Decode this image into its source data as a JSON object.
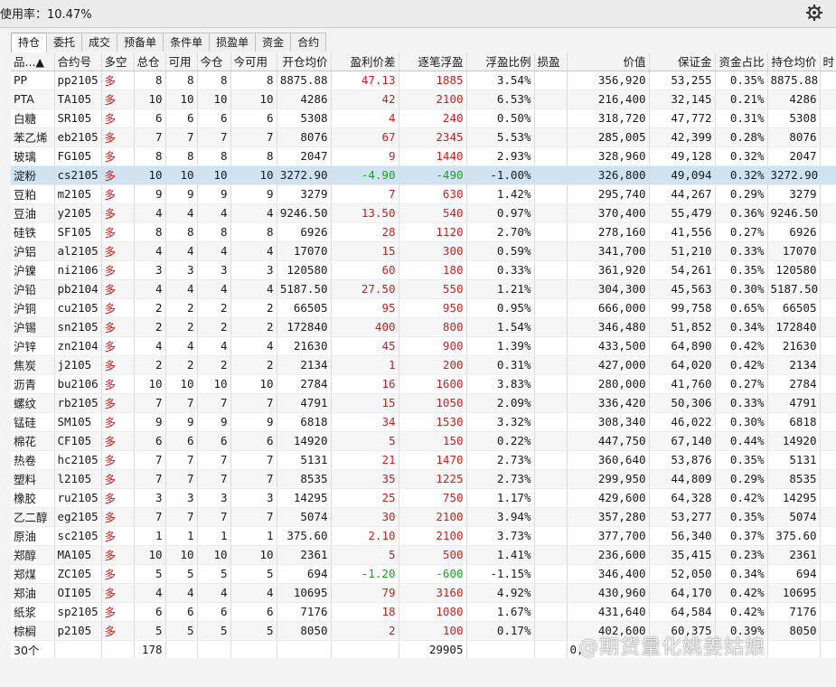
{
  "topbar": {
    "usage_text": "使用率：10.47%"
  },
  "tabs": [
    "持仓",
    "委托",
    "成交",
    "预备单",
    "条件单",
    "损盈单",
    "资金",
    "合约"
  ],
  "columns": [
    "品...▲",
    "合约号",
    "多空",
    "总仓",
    "可用",
    "今仓",
    "今可用",
    "开仓均价",
    "盈利价差",
    "逐笔浮盈",
    "浮盈比例",
    "损盈",
    "价值",
    "保证金",
    "资金占比",
    "持仓均价",
    "时"
  ],
  "rows": [
    [
      "PP",
      "pp2105",
      "多",
      "8",
      "8",
      "8",
      "8",
      "8875.88",
      "47.13",
      "1885",
      "3.54%",
      "",
      "356,920",
      "53,255",
      "0.35%",
      "8875.88"
    ],
    [
      "PTA",
      "TA105",
      "多",
      "10",
      "10",
      "10",
      "10",
      "4286",
      "42",
      "2100",
      "6.53%",
      "",
      "216,400",
      "32,145",
      "0.21%",
      "4286"
    ],
    [
      "白糖",
      "SR105",
      "多",
      "6",
      "6",
      "6",
      "6",
      "5308",
      "4",
      "240",
      "0.50%",
      "",
      "318,720",
      "47,772",
      "0.31%",
      "5308"
    ],
    [
      "苯乙烯",
      "eb2105",
      "多",
      "7",
      "7",
      "7",
      "7",
      "8076",
      "67",
      "2345",
      "5.53%",
      "",
      "285,005",
      "42,399",
      "0.28%",
      "8076"
    ],
    [
      "玻璃",
      "FG105",
      "多",
      "8",
      "8",
      "8",
      "8",
      "2047",
      "9",
      "1440",
      "2.93%",
      "",
      "328,960",
      "49,128",
      "0.32%",
      "2047"
    ],
    [
      "淀粉",
      "cs2105",
      "多",
      "10",
      "10",
      "10",
      "10",
      "3272.90",
      "-4.90",
      "-490",
      "-1.00%",
      "",
      "326,800",
      "49,094",
      "0.32%",
      "3272.90"
    ],
    [
      "豆粕",
      "m2105",
      "多",
      "9",
      "9",
      "9",
      "9",
      "3279",
      "7",
      "630",
      "1.42%",
      "",
      "295,740",
      "44,267",
      "0.29%",
      "3279"
    ],
    [
      "豆油",
      "y2105",
      "多",
      "4",
      "4",
      "4",
      "4",
      "9246.50",
      "13.50",
      "540",
      "0.97%",
      "",
      "370,400",
      "55,479",
      "0.36%",
      "9246.50"
    ],
    [
      "硅铁",
      "SF105",
      "多",
      "8",
      "8",
      "8",
      "8",
      "6926",
      "28",
      "1120",
      "2.70%",
      "",
      "278,160",
      "41,556",
      "0.27%",
      "6926"
    ],
    [
      "沪铝",
      "al2105",
      "多",
      "4",
      "4",
      "4",
      "4",
      "17070",
      "15",
      "300",
      "0.59%",
      "",
      "341,700",
      "51,210",
      "0.33%",
      "17070"
    ],
    [
      "沪镍",
      "ni2106",
      "多",
      "3",
      "3",
      "3",
      "3",
      "120580",
      "60",
      "180",
      "0.33%",
      "",
      "361,920",
      "54,261",
      "0.35%",
      "120580"
    ],
    [
      "沪铅",
      "pb2104",
      "多",
      "4",
      "4",
      "4",
      "4",
      "5187.50",
      "27.50",
      "550",
      "1.21%",
      "",
      "304,300",
      "45,563",
      "0.30%",
      "5187.50"
    ],
    [
      "沪铜",
      "cu2105",
      "多",
      "2",
      "2",
      "2",
      "2",
      "66505",
      "95",
      "950",
      "0.95%",
      "",
      "666,000",
      "99,758",
      "0.65%",
      "66505"
    ],
    [
      "沪锡",
      "sn2105",
      "多",
      "2",
      "2",
      "2",
      "2",
      "172840",
      "400",
      "800",
      "1.54%",
      "",
      "346,480",
      "51,852",
      "0.34%",
      "172840"
    ],
    [
      "沪锌",
      "zn2104",
      "多",
      "4",
      "4",
      "4",
      "4",
      "21630",
      "45",
      "900",
      "1.39%",
      "",
      "433,500",
      "64,890",
      "0.42%",
      "21630"
    ],
    [
      "焦炭",
      "j2105",
      "多",
      "2",
      "2",
      "2",
      "2",
      "2134",
      "1",
      "200",
      "0.31%",
      "",
      "427,000",
      "64,020",
      "0.42%",
      "2134"
    ],
    [
      "沥青",
      "bu2106",
      "多",
      "10",
      "10",
      "10",
      "10",
      "2784",
      "16",
      "1600",
      "3.83%",
      "",
      "280,000",
      "41,760",
      "0.27%",
      "2784"
    ],
    [
      "螺纹",
      "rb2105",
      "多",
      "7",
      "7",
      "7",
      "7",
      "4791",
      "15",
      "1050",
      "2.09%",
      "",
      "336,420",
      "50,306",
      "0.33%",
      "4791"
    ],
    [
      "锰硅",
      "SM105",
      "多",
      "9",
      "9",
      "9",
      "9",
      "6818",
      "34",
      "1530",
      "3.32%",
      "",
      "308,340",
      "46,022",
      "0.30%",
      "6818"
    ],
    [
      "棉花",
      "CF105",
      "多",
      "6",
      "6",
      "6",
      "6",
      "14920",
      "5",
      "150",
      "0.22%",
      "",
      "447,750",
      "67,140",
      "0.44%",
      "14920"
    ],
    [
      "热卷",
      "hc2105",
      "多",
      "7",
      "7",
      "7",
      "7",
      "5131",
      "21",
      "1470",
      "2.73%",
      "",
      "360,640",
      "53,876",
      "0.35%",
      "5131"
    ],
    [
      "塑料",
      "l2105",
      "多",
      "7",
      "7",
      "7",
      "7",
      "8535",
      "35",
      "1225",
      "2.73%",
      "",
      "299,950",
      "44,809",
      "0.29%",
      "8535"
    ],
    [
      "橡胶",
      "ru2105",
      "多",
      "3",
      "3",
      "3",
      "3",
      "14295",
      "25",
      "750",
      "1.17%",
      "",
      "429,600",
      "64,328",
      "0.42%",
      "14295"
    ],
    [
      "乙二醇",
      "eg2105",
      "多",
      "7",
      "7",
      "7",
      "7",
      "5074",
      "30",
      "2100",
      "3.94%",
      "",
      "357,280",
      "53,277",
      "0.35%",
      "5074"
    ],
    [
      "原油",
      "sc2105",
      "多",
      "1",
      "1",
      "1",
      "1",
      "375.60",
      "2.10",
      "2100",
      "3.73%",
      "",
      "377,700",
      "56,340",
      "0.37%",
      "375.60"
    ],
    [
      "郑醇",
      "MA105",
      "多",
      "10",
      "10",
      "10",
      "10",
      "2361",
      "5",
      "500",
      "1.41%",
      "",
      "236,600",
      "35,415",
      "0.23%",
      "2361"
    ],
    [
      "郑煤",
      "ZC105",
      "多",
      "5",
      "5",
      "5",
      "5",
      "694",
      "-1.20",
      "-600",
      "-1.15%",
      "",
      "346,400",
      "52,050",
      "0.34%",
      "694"
    ],
    [
      "郑油",
      "OI105",
      "多",
      "4",
      "4",
      "4",
      "4",
      "10695",
      "79",
      "3160",
      "4.92%",
      "",
      "430,960",
      "64,170",
      "0.42%",
      "10695"
    ],
    [
      "纸浆",
      "sp2105",
      "多",
      "6",
      "6",
      "6",
      "6",
      "7176",
      "18",
      "1080",
      "1.67%",
      "",
      "431,640",
      "64,584",
      "0.42%",
      "7176"
    ],
    [
      "棕榈",
      "p2105",
      "多",
      "5",
      "5",
      "5",
      "5",
      "8050",
      "2",
      "100",
      "0.17%",
      "",
      "402,600",
      "60,375",
      "0.39%",
      "8050"
    ]
  ],
  "footer": {
    "count": "30个",
    "total_position": "178",
    "total_float": "29905",
    "value_partial": "0,"
  },
  "selected_row_index": 5,
  "watermark": "@期货量化姚姜姑娘",
  "colors": {
    "profit": "#d21c1c",
    "loss": "#16a51c",
    "selected": "#cfe3f3"
  }
}
